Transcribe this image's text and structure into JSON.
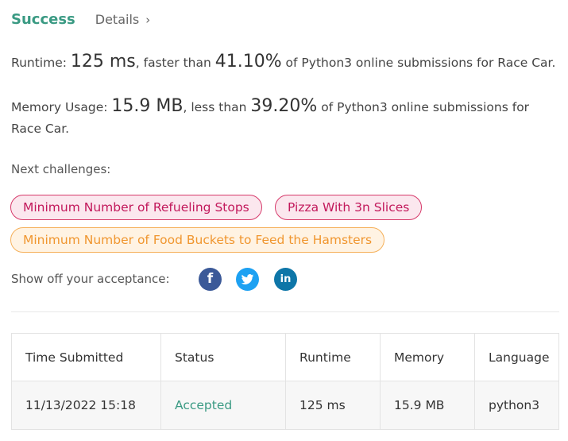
{
  "header": {
    "status": "Success",
    "details_label": "Details"
  },
  "runtime": {
    "label": "Runtime: ",
    "value": "125 ms",
    "mid": ", faster than ",
    "percent": "41.10%",
    "tail": " of Python3 online submissions for Race Car."
  },
  "memory": {
    "label": "Memory Usage: ",
    "value": "15.9 MB",
    "mid": ", less than ",
    "percent": "39.20%",
    "tail": " of Python3 online submissions for Race Car."
  },
  "next": {
    "label": "Next challenges:",
    "challenges": [
      {
        "title": "Minimum Number of Refueling Stops",
        "difficulty_color": "#d6396a"
      },
      {
        "title": "Pizza With 3n Slices",
        "difficulty_color": "#d6396a"
      },
      {
        "title": "Minimum Number of Food Buckets to Feed the Hamsters",
        "difficulty_color": "#f5b05a"
      }
    ]
  },
  "share": {
    "label": "Show off your acceptance:",
    "icons": [
      "facebook-icon",
      "twitter-icon",
      "linkedin-icon"
    ]
  },
  "table": {
    "headers": [
      "Time Submitted",
      "Status",
      "Runtime",
      "Memory",
      "Language"
    ],
    "rows": [
      [
        "11/13/2022 15:18",
        "Accepted",
        "125 ms",
        "15.9 MB",
        "python3"
      ]
    ]
  },
  "colors": {
    "accent": "#3a9a83",
    "hard": "#d6396a",
    "medium": "#f5b05a"
  }
}
